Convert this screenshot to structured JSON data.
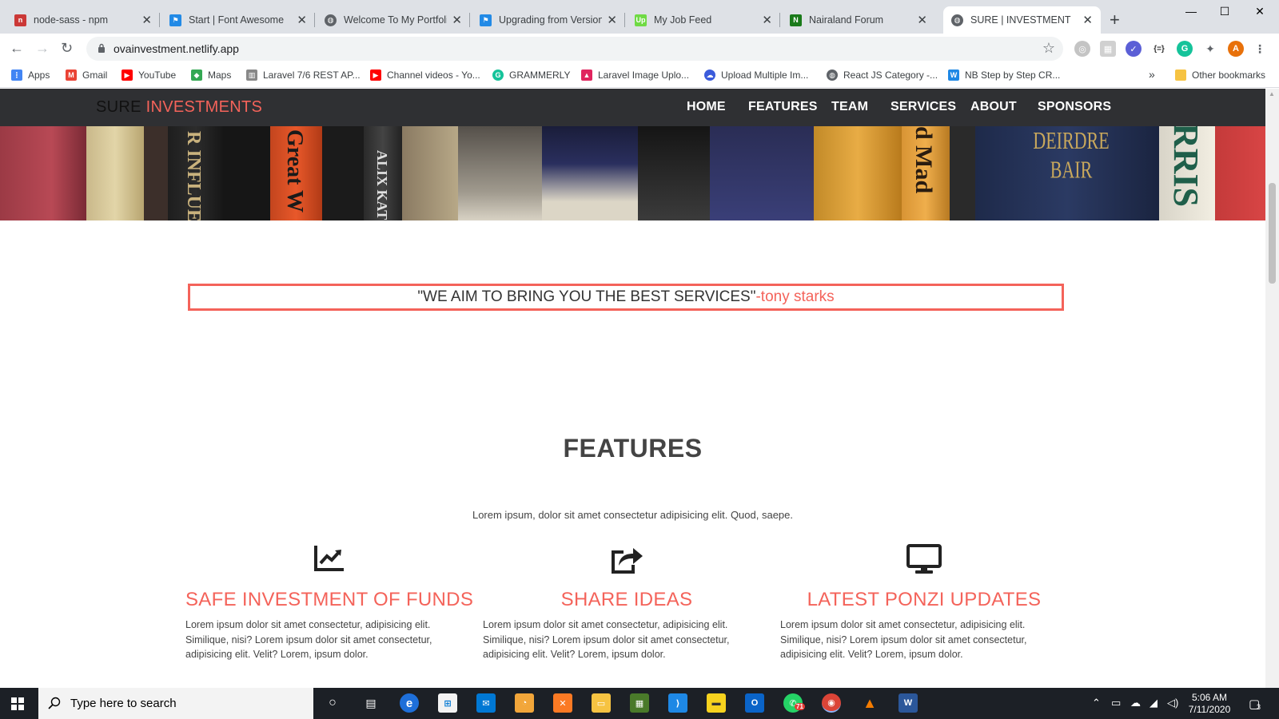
{
  "browser": {
    "tabs": [
      {
        "title": "node-sass - npm",
        "icon": "npm-icon",
        "color": "#cb3837"
      },
      {
        "title": "Start | Font Awesome",
        "icon": "flag-icon",
        "color": "#228ae6"
      },
      {
        "title": "Welcome To My Portfolio",
        "icon": "globe-icon",
        "color": "#5f6368"
      },
      {
        "title": "Upgrading from Version",
        "icon": "flag-icon",
        "color": "#228ae6"
      },
      {
        "title": "My Job Feed",
        "icon": "upwork-icon",
        "color": "#6fda44"
      },
      {
        "title": "Nairaland Forum",
        "icon": "nairaland-icon",
        "color": "#1a7a1a"
      },
      {
        "title": "SURE | INVESTMENT",
        "icon": "globe-icon",
        "color": "#5f6368"
      }
    ],
    "active_tab": 6,
    "url": "ovainvestment.netlify.app",
    "profile_initial": "A",
    "bookmarks": [
      {
        "label": "Apps",
        "icon": "apps-grid-icon",
        "color": "#4285f4"
      },
      {
        "label": "Gmail",
        "icon": "gmail-icon",
        "color": "#ea4335"
      },
      {
        "label": "YouTube",
        "icon": "youtube-icon",
        "color": "#ff0000"
      },
      {
        "label": "Maps",
        "icon": "maps-icon",
        "color": "#34a853"
      },
      {
        "label": "Laravel 7/6 REST AP...",
        "icon": "site-icon",
        "color": "#888888"
      },
      {
        "label": "Channel videos - Yo...",
        "icon": "youtube-icon",
        "color": "#ff0000"
      },
      {
        "label": "GRAMMERLY",
        "icon": "grammarly-icon",
        "color": "#15c39a"
      },
      {
        "label": "Laravel Image Uplo...",
        "icon": "site-icon",
        "color": "#e0245e"
      },
      {
        "label": "Upload Multiple Im...",
        "icon": "cloud-icon",
        "color": "#3b5bdb"
      },
      {
        "label": "React JS Category -...",
        "icon": "globe-icon",
        "color": "#5f6368"
      },
      {
        "label": "NB Step by Step CR...",
        "icon": "w-icon",
        "color": "#1e88e5"
      }
    ],
    "overflow_label": "»",
    "other_bookmarks": "Other bookmarks"
  },
  "site": {
    "brand_part1": "SURE",
    "brand_part2": "INVESTMENTS",
    "nav": [
      "HOME",
      "FEATURES",
      "TEAM",
      "SERVICES",
      "ABOUT",
      "SPONSORS"
    ],
    "hero_spines": [
      "R INFLUEN",
      "Great W",
      "ALIX KAT",
      "d Mad",
      "DEIRDRE BAIR",
      "RRIS"
    ],
    "quote": "\"WE AIM TO BRING YOU THE BEST SERVICES\"",
    "quote_author": "-tony starks",
    "features_title": "FEATURES",
    "features_subtitle": "Lorem ipsum, dolor sit amet consectetur adipisicing elit. Quod, saepe.",
    "features": [
      {
        "title": "SAFE INVESTMENT OF FUNDS",
        "icon": "chart-line-icon",
        "text": "Lorem ipsum dolor sit amet consectetur, adipisicing elit. Similique, nisi? Lorem ipsum dolor sit amet consectetur, adipisicing elit. Velit? Lorem, ipsum dolor."
      },
      {
        "title": "SHARE IDEAS",
        "icon": "share-square-icon",
        "text": "Lorem ipsum dolor sit amet consectetur, adipisicing elit. Similique, nisi? Lorem ipsum dolor sit amet consectetur, adipisicing elit. Velit? Lorem, ipsum dolor."
      },
      {
        "title": "LATEST PONZI UPDATES",
        "icon": "desktop-icon",
        "text": "Lorem ipsum dolor sit amet consectetur, adipisicing elit. Similique, nisi? Lorem ipsum dolor sit amet consectetur, adipisicing elit. Velit? Lorem, ipsum dolor."
      }
    ],
    "accent_color": "#f4635a",
    "navbar_color": "#2f3033"
  },
  "taskbar": {
    "search_placeholder": "Type here to search",
    "whatsapp_badge": "71",
    "time": "5:06 AM",
    "date": "7/11/2020",
    "notifications": "3"
  }
}
